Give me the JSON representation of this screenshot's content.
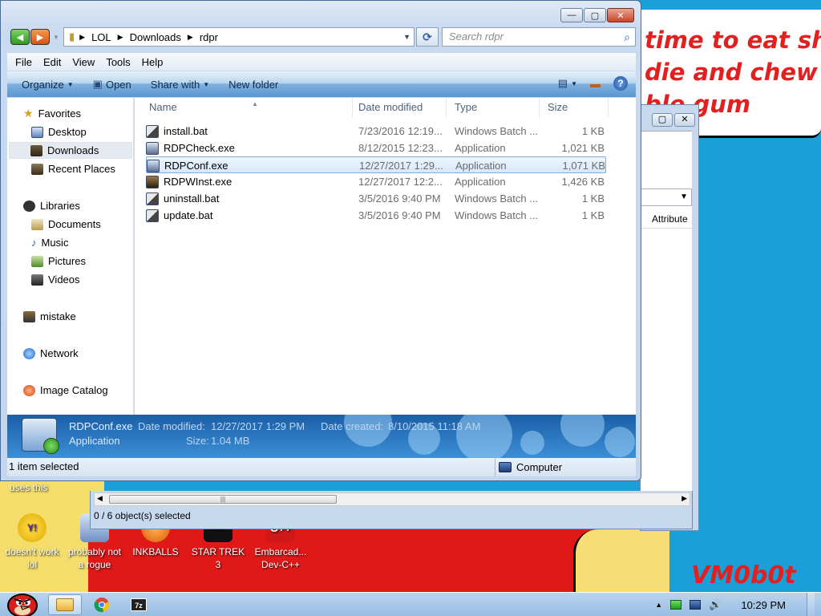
{
  "wallpaper": {
    "text_line1": "time to eat shit",
    "text_line2": "die and chew",
    "text_line3": "ble gum",
    "signature": "VM0b0t",
    "uses_label": "uses this"
  },
  "desktop_icons": [
    {
      "label": "doesn't work lol",
      "icon": "yahoo-messenger-icon"
    },
    {
      "label": "probably not a rogue",
      "icon": "computer-shield-icon"
    },
    {
      "label": "INKBALLS",
      "icon": "inkballs-icon"
    },
    {
      "label": "STAR TREK 3",
      "icon": "star-wars-icon"
    },
    {
      "label": "Embarcad... Dev-C++",
      "icon": "cpp-icon"
    }
  ],
  "background_window": {
    "attribute_header": "Attribute",
    "status": "0 / 6 object(s) selected"
  },
  "window": {
    "address": {
      "crumbs": [
        "LOL",
        "Downloads",
        "rdpr"
      ],
      "search_placeholder": "Search rdpr"
    },
    "menu": [
      "File",
      "Edit",
      "View",
      "Tools",
      "Help"
    ],
    "commands": {
      "organize": "Organize",
      "open": "Open",
      "share": "Share with",
      "new_folder": "New folder"
    },
    "nav": {
      "favorites": "Favorites",
      "desktop": "Desktop",
      "downloads": "Downloads",
      "recent": "Recent Places",
      "libraries": "Libraries",
      "documents": "Documents",
      "music": "Music",
      "pictures": "Pictures",
      "videos": "Videos",
      "mistake": "mistake",
      "network": "Network",
      "image_catalog": "Image Catalog"
    },
    "columns": {
      "name": "Name",
      "date": "Date modified",
      "type": "Type",
      "size": "Size"
    },
    "files": [
      {
        "name": "install.bat",
        "date": "7/23/2016 12:19...",
        "type": "Windows Batch ...",
        "size": "1 KB",
        "kind": "bat"
      },
      {
        "name": "RDPCheck.exe",
        "date": "8/12/2015 12:23...",
        "type": "Application",
        "size": "1,021 KB",
        "kind": "exe"
      },
      {
        "name": "RDPConf.exe",
        "date": "12/27/2017 1:29...",
        "type": "Application",
        "size": "1,071 KB",
        "kind": "exe"
      },
      {
        "name": "RDPWInst.exe",
        "date": "12/27/2017 12:2...",
        "type": "Application",
        "size": "1,426 KB",
        "kind": "exe"
      },
      {
        "name": "uninstall.bat",
        "date": "3/5/2016 9:40 PM",
        "type": "Windows Batch ...",
        "size": "1 KB",
        "kind": "bat"
      },
      {
        "name": "update.bat",
        "date": "3/5/2016 9:40 PM",
        "type": "Windows Batch ...",
        "size": "1 KB",
        "kind": "bat"
      }
    ],
    "selected_index": 2,
    "details": {
      "filename": "RDPConf.exe",
      "type": "Application",
      "date_modified_label": "Date modified:",
      "date_modified": "12/27/2017 1:29 PM",
      "date_created_label": "Date created:",
      "date_created": "8/10/2015 11:18 AM",
      "size_label": "Size:",
      "size": "1.04 MB"
    },
    "status": {
      "left": "1 item selected",
      "right": "Computer"
    }
  },
  "taskbar": {
    "time": "10:29 PM",
    "pinned": [
      "explorer-icon",
      "chrome-icon",
      "7zip-icon"
    ]
  },
  "colors": {
    "desktop": "#1a9fd8",
    "accent_red": "#e01818",
    "selection": "#d6e8fb"
  }
}
